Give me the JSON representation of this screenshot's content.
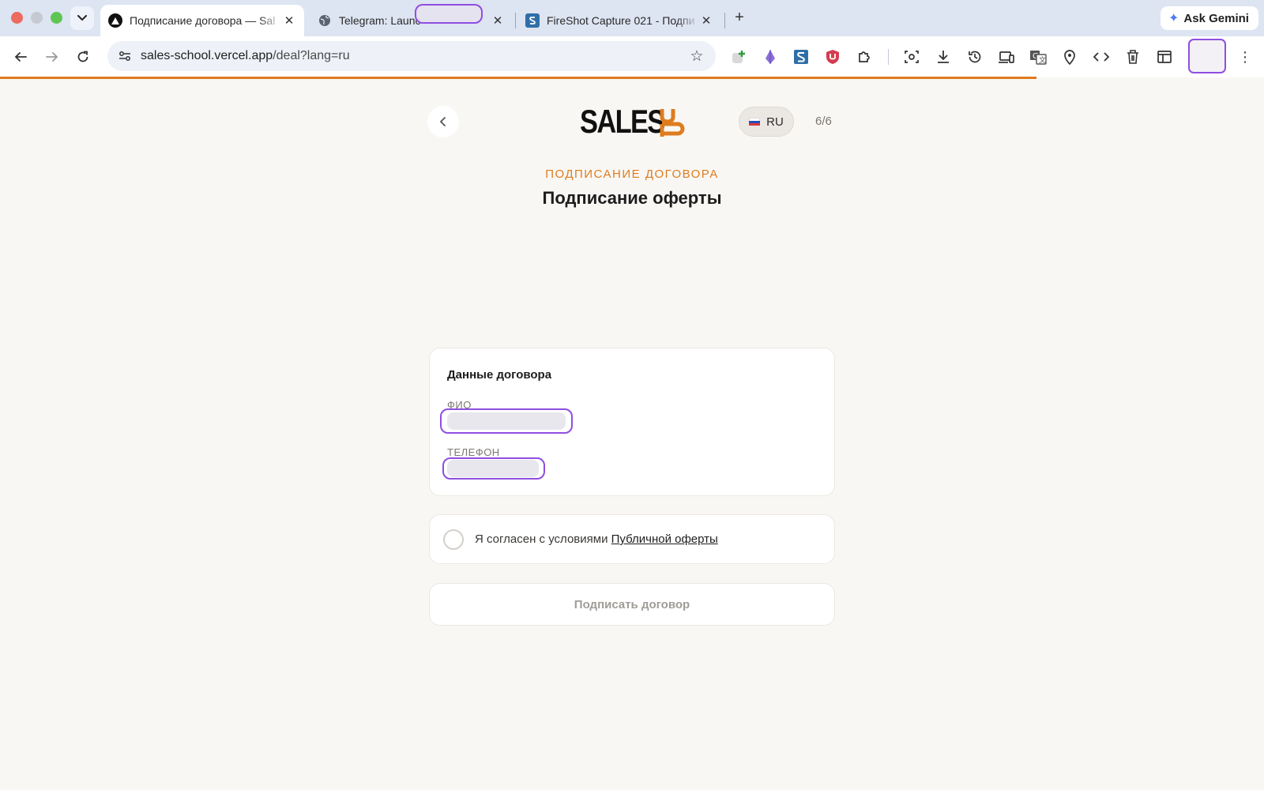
{
  "browser": {
    "tabs": [
      {
        "title": "Подписание договора — Sal",
        "active": true,
        "icon": "vercel-triangle-icon"
      },
      {
        "title": "Telegram: Launc",
        "active": false,
        "icon": "globe-icon"
      },
      {
        "title": "FireShot Capture 021 - Подпи",
        "active": false,
        "icon": "fireshot-icon"
      }
    ],
    "new_tab": "+",
    "gemini_label": "Ask Gemini",
    "url_host": "sales-school.vercel.app",
    "url_path": "/deal?lang=ru",
    "page_load_progress": 0.82,
    "extensions": [
      "extension-add-icon",
      "extension-crystal-icon",
      "fireshot-icon",
      "ublock-icon",
      "extensions-puzzle-icon",
      "screenshot-icon",
      "download-icon",
      "history-icon",
      "devices-icon",
      "translate-icon",
      "location-pin-icon",
      "code-icon",
      "trash-icon",
      "layout-icon"
    ]
  },
  "page": {
    "logo": {
      "text": "SALES",
      "accent": "#de7c1f"
    },
    "lang": "RU",
    "step": "6/6",
    "eyebrow": "ПОДПИСАНИЕ ДОГОВОРА",
    "title": "Подписание оферты",
    "contract": {
      "title": "Данные договора",
      "name_label": "ФИО",
      "phone_label": "ТЕЛЕФОН"
    },
    "consent": {
      "text": "Я согласен с условиями ",
      "link": "Публичной оферты",
      "checked": false
    },
    "submit_label": "Подписать договор",
    "colors": {
      "accent": "#de7c1f",
      "background": "#f9f7f4",
      "redaction": "#8f4ee0"
    }
  }
}
